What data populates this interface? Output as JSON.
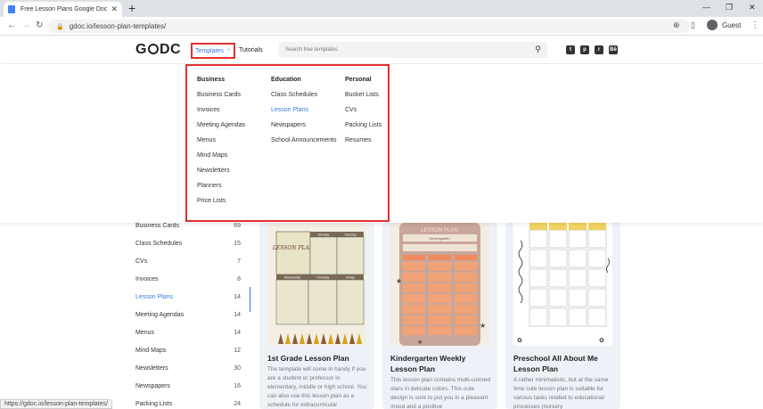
{
  "browser": {
    "tab_title": "Free Lesson Plans Google Docs T...",
    "url": "gdoc.io/lesson-plan-templates/",
    "profile": "Guest",
    "status_url": "https://gdoc.io/lesson-plan-templates/"
  },
  "header": {
    "logo_g": "G",
    "logo_dc": "DC",
    "templates_label": "Templates",
    "tutorials_label": "Tutorials",
    "search_placeholder": "Search free templates"
  },
  "dropdown": {
    "columns": [
      {
        "heading": "Business",
        "items": [
          "Business Cards",
          "Invoices",
          "Meeting Agendas",
          "Menus",
          "Mind Maps",
          "Newsletters",
          "Planners",
          "Price Lists"
        ]
      },
      {
        "heading": "Education",
        "items": [
          "Class Schedules",
          "Lesson Plans",
          "Newspapers",
          "School Announcements"
        ]
      },
      {
        "heading": "Personal",
        "items": [
          "Bucket Lists",
          "CVs",
          "Packing Lists",
          "Resumes"
        ]
      }
    ]
  },
  "sidebar": {
    "items": [
      {
        "label": "Business Cards",
        "count": "69"
      },
      {
        "label": "Class Schedules",
        "count": "15"
      },
      {
        "label": "CVs",
        "count": "7"
      },
      {
        "label": "Invoices",
        "count": "8"
      },
      {
        "label": "Lesson Plans",
        "count": "14"
      },
      {
        "label": "Meeting Agendas",
        "count": "14"
      },
      {
        "label": "Menus",
        "count": "14"
      },
      {
        "label": "Mind Maps",
        "count": "12"
      },
      {
        "label": "Newsletters",
        "count": "30"
      },
      {
        "label": "Newspapers",
        "count": "16"
      },
      {
        "label": "Packing Lists",
        "count": "24"
      }
    ]
  },
  "cards": [
    {
      "title": "1st Grade Lesson Plan",
      "description": "The template will come in handy if you are a student or professor in elementary, middle or high school. You can also use this lesson plan as a schedule for extracurricular",
      "thumb_heading": "LESSON PLAN",
      "thumb_days": [
        "Monday",
        "Tuesday",
        "Wednesday",
        "Thursday",
        "Friday"
      ]
    },
    {
      "title": "Kindergarten Weekly Lesson Plan",
      "description": "This lesson plan contains multi-colored stars in delicate colors. This cute design is sure to put you in a pleasant mood and a positive",
      "thumb_heading": "LESSON PLAN",
      "thumb_sub": "Kindergarten"
    },
    {
      "title": "Preschool All About Me Lesson Plan",
      "description": "A rather minimalistic, but at the same time cute lesson plan is suitable for various tasks related to educational processes (nursery",
      "thumb_heading": ""
    }
  ],
  "colors": {
    "accent": "#3d7ad6",
    "highlight_border": "#e03030"
  }
}
